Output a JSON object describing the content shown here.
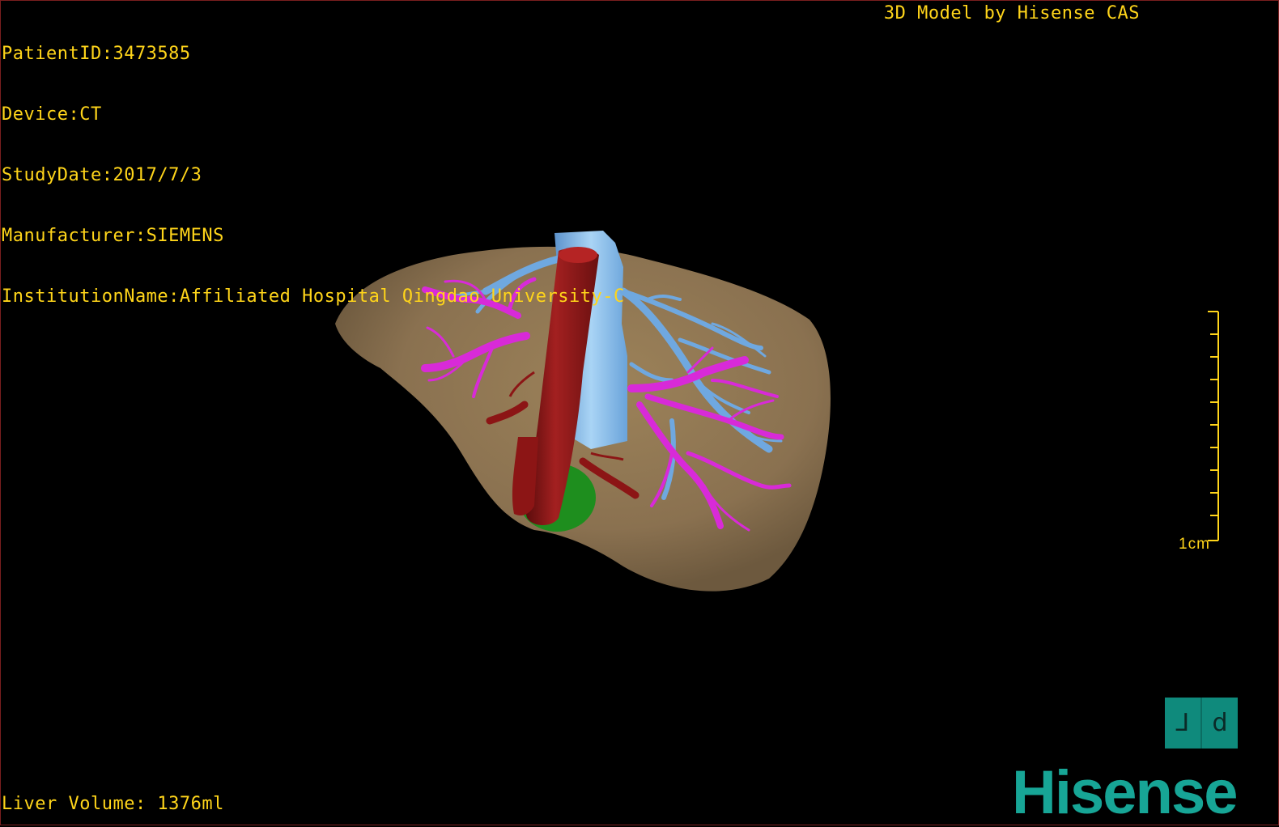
{
  "header": {
    "patient_id": "PatientID:3473585",
    "device": "Device:CT",
    "study_date": "StudyDate:2017/7/3",
    "manufacturer": "Manufacturer:SIEMENS",
    "institution": "InstitutionName:Affiliated Hospital Qingdao University-C",
    "model_by": "3D Model by Hisense CAS"
  },
  "footer": {
    "liver_volume": "Liver Volume: 1376ml"
  },
  "scale_bar": {
    "label": "1cm"
  },
  "orientation": {
    "left_glyph": "⅃",
    "right_glyph": "d"
  },
  "brand": {
    "logo_text": "Hisense"
  },
  "colors": {
    "overlay_text": "#ffd51a",
    "liver": "#8b7350",
    "hepatic_vein": "#6fa8e0",
    "portal_vein": "#d82ad8",
    "vena_cava": "#8c1515",
    "gallbladder": "#1e8e1e",
    "brand": "#17a596"
  }
}
